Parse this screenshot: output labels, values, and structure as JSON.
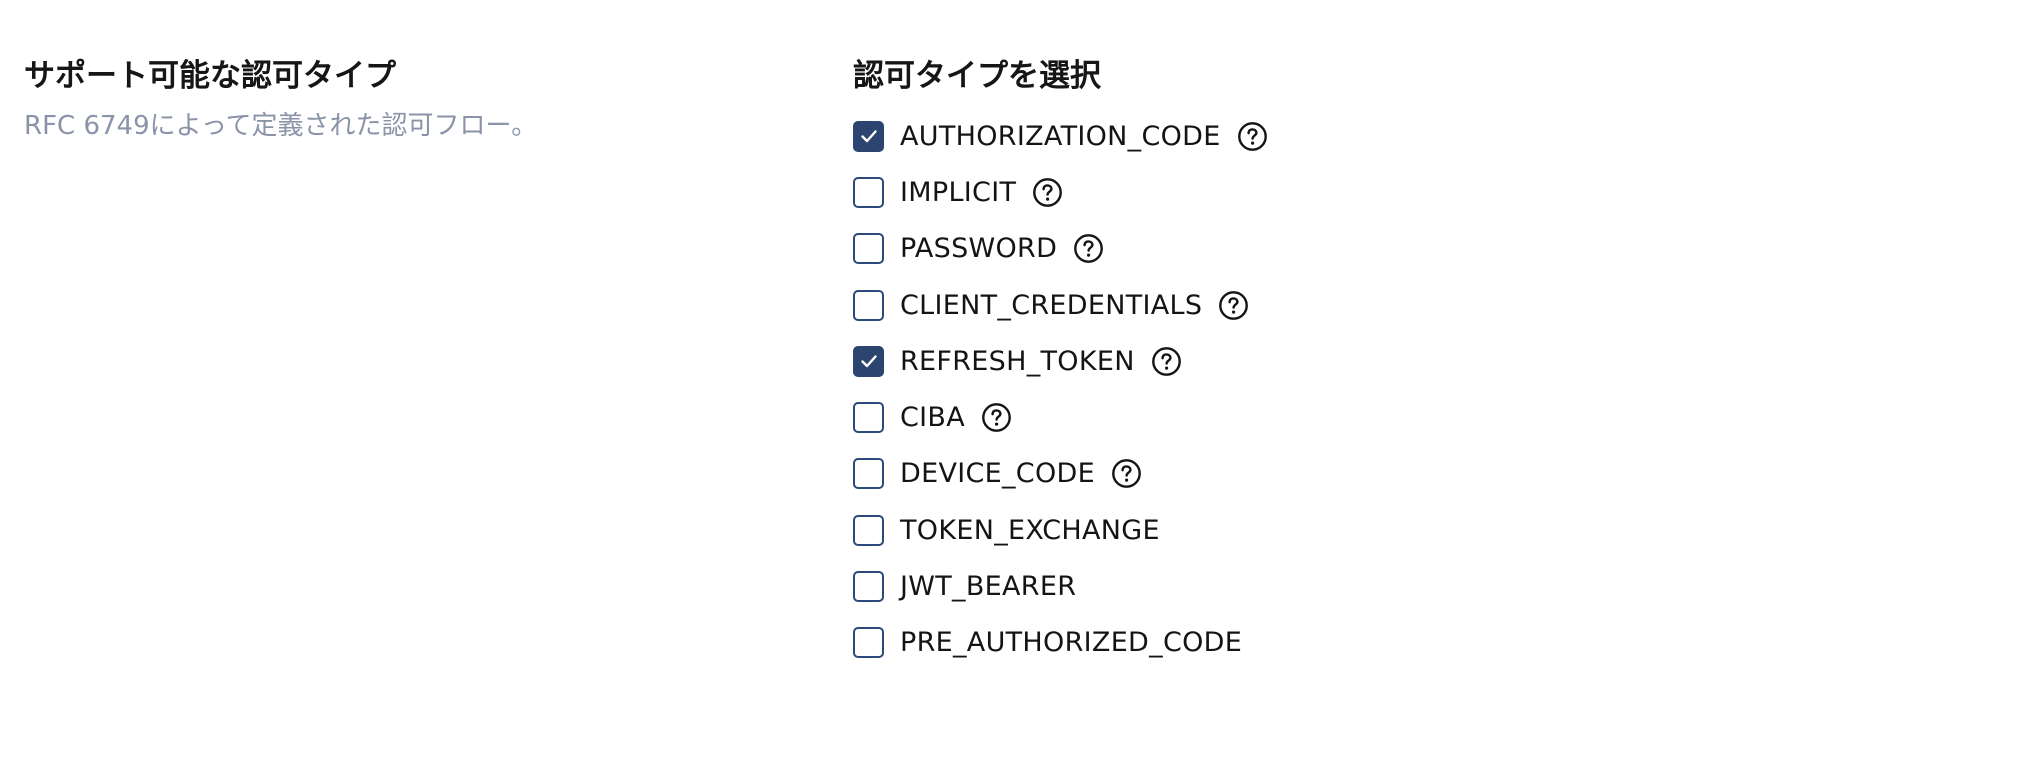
{
  "section": {
    "title": "サポート可能な認可タイプ",
    "description": "RFC 6749によって定義された認可フロー。"
  },
  "select": {
    "title": "認可タイプを選択"
  },
  "colors": {
    "checkbox_checked": "#2b4570",
    "checkbox_border": "#2b4a7a",
    "description_text": "#8a93a8"
  },
  "grant_types": [
    {
      "label": "AUTHORIZATION_CODE",
      "checked": true,
      "has_help": true
    },
    {
      "label": "IMPLICIT",
      "checked": false,
      "has_help": true
    },
    {
      "label": "PASSWORD",
      "checked": false,
      "has_help": true
    },
    {
      "label": "CLIENT_CREDENTIALS",
      "checked": false,
      "has_help": true
    },
    {
      "label": "REFRESH_TOKEN",
      "checked": true,
      "has_help": true
    },
    {
      "label": "CIBA",
      "checked": false,
      "has_help": true
    },
    {
      "label": "DEVICE_CODE",
      "checked": false,
      "has_help": true
    },
    {
      "label": "TOKEN_EXCHANGE",
      "checked": false,
      "has_help": false
    },
    {
      "label": "JWT_BEARER",
      "checked": false,
      "has_help": false
    },
    {
      "label": "PRE_AUTHORIZED_CODE",
      "checked": false,
      "has_help": false
    }
  ]
}
